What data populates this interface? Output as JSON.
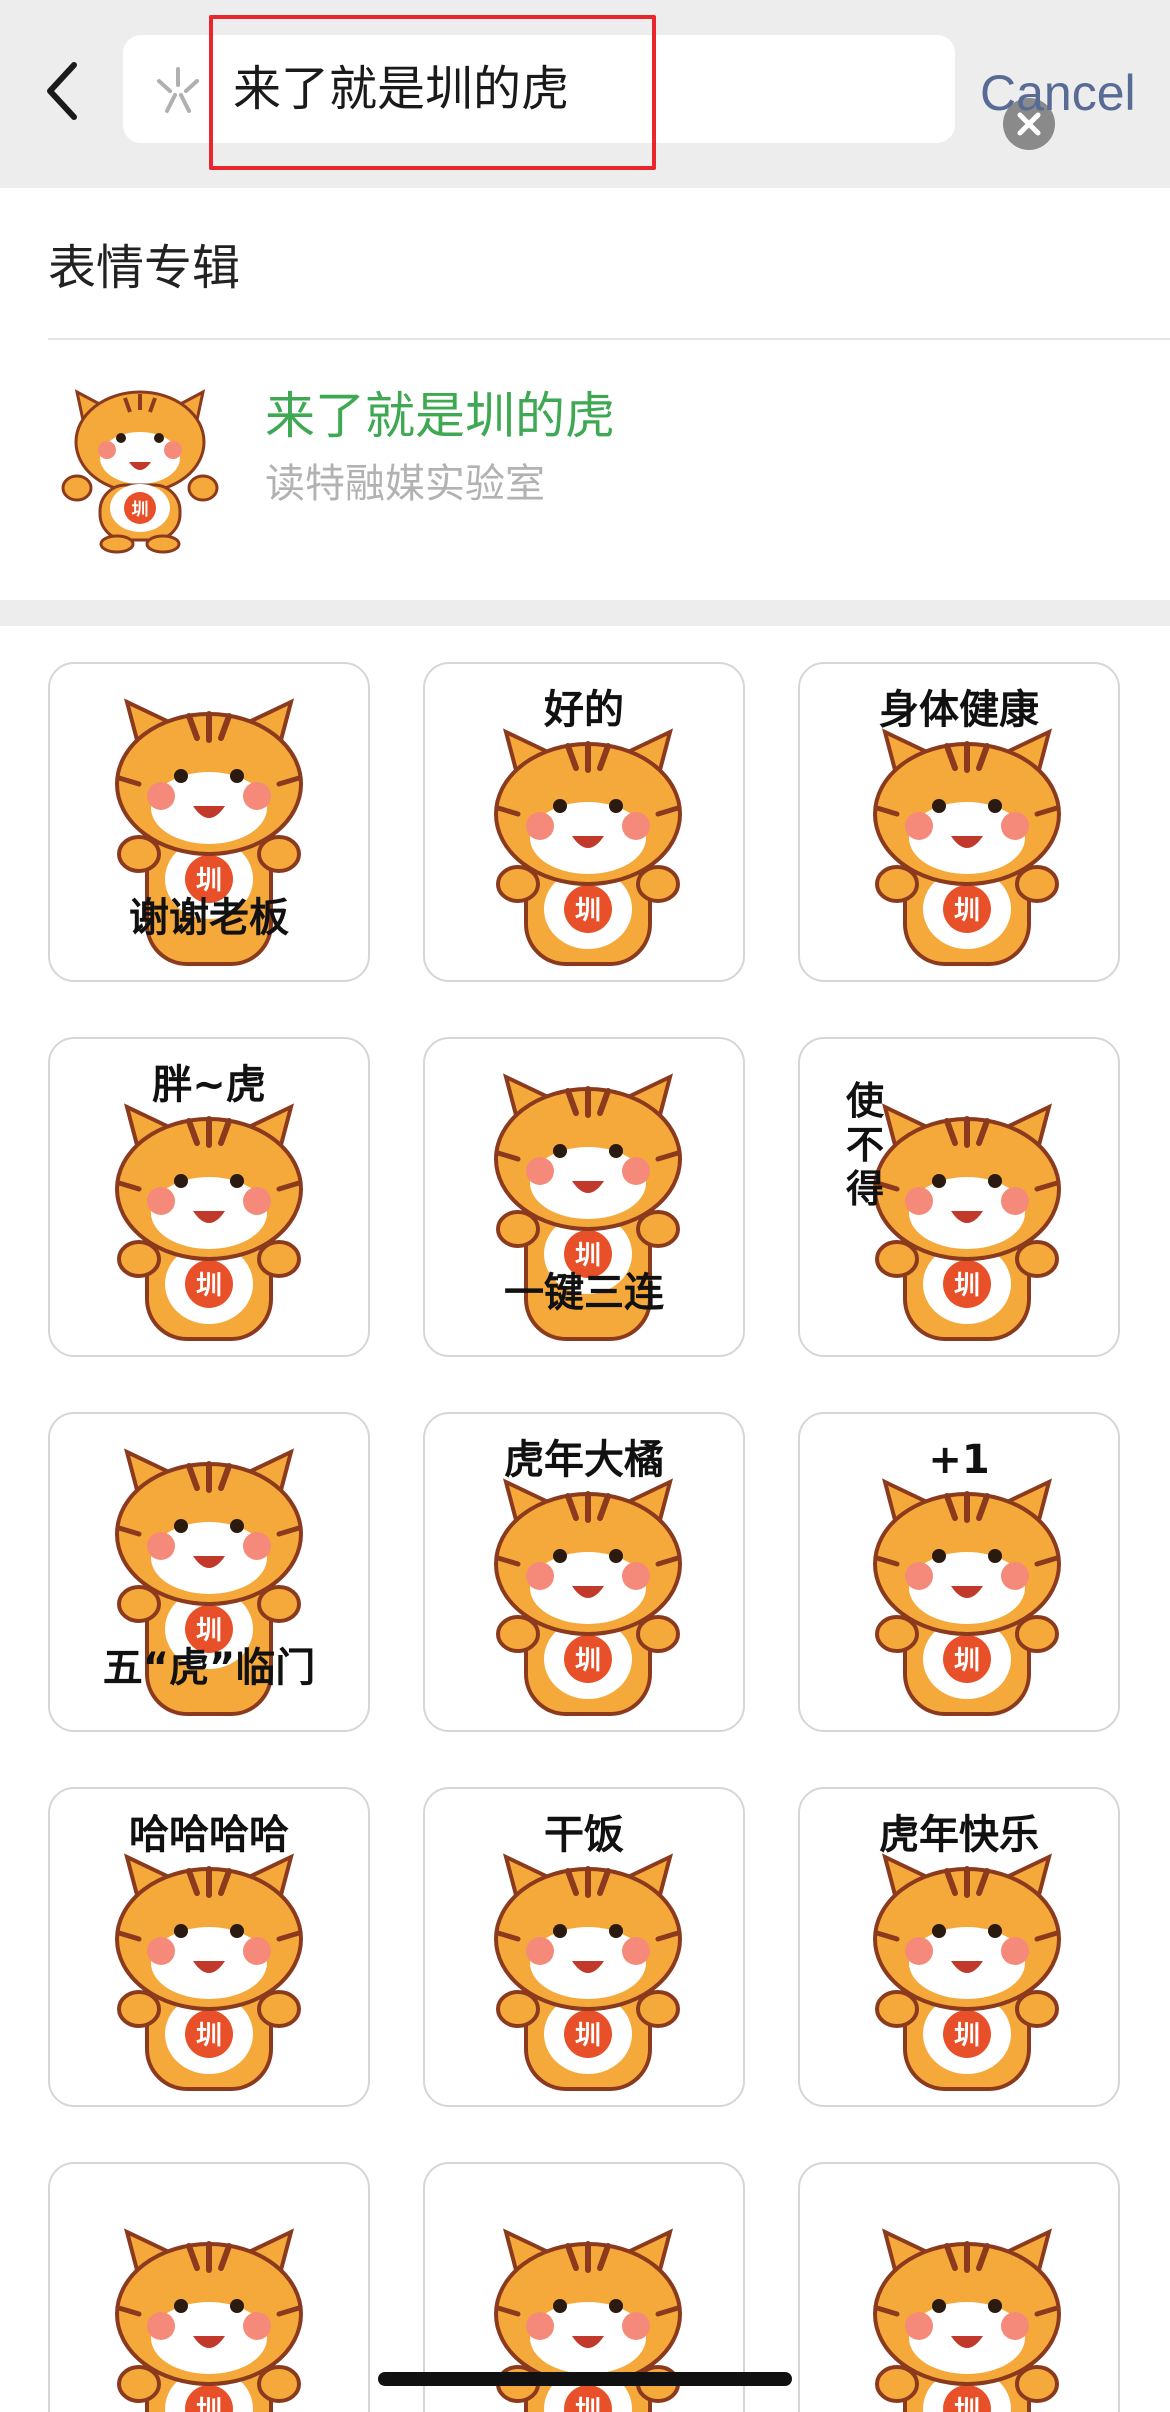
{
  "search": {
    "query": "来了就是圳的虎",
    "cancel_label": "Cancel"
  },
  "section": {
    "title": "表情专辑"
  },
  "album": {
    "name": "来了就是圳的虎",
    "author": "读特融媒实验室"
  },
  "colors": {
    "header_bg": "#ededed",
    "accent_green": "#3fa853",
    "cancel_blue": "#586b95",
    "highlight_red": "#e8262b",
    "tiger_orange": "#f6a93b",
    "tiger_stripe": "#8b3a1e",
    "badge_red": "#e8502a"
  },
  "icons": {
    "back": "chevron-left-icon",
    "search": "sticker-search-icon",
    "clear": "clear-icon"
  },
  "stickers": [
    {
      "caption": "谢谢老板"
    },
    {
      "caption": "好的"
    },
    {
      "caption": "身体健康"
    },
    {
      "caption": "胖~虎"
    },
    {
      "caption": "一键三连"
    },
    {
      "caption": "使不得"
    },
    {
      "caption": "五“虎”临门"
    },
    {
      "caption": "虎年大橘"
    },
    {
      "caption": "+1"
    },
    {
      "caption": "哈哈哈哈"
    },
    {
      "caption": "干饭"
    },
    {
      "caption": "虎年快乐"
    },
    {
      "caption": ""
    },
    {
      "caption": ""
    },
    {
      "caption": ""
    }
  ]
}
